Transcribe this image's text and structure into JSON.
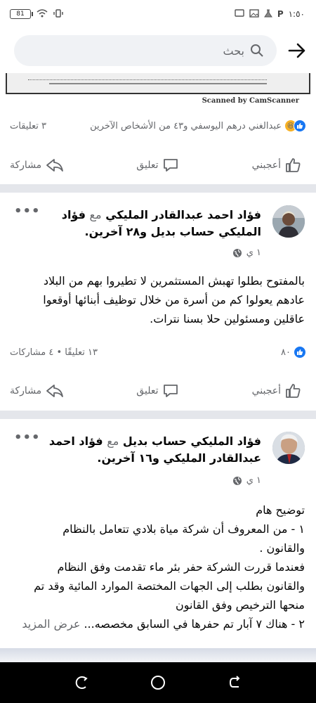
{
  "status_bar": {
    "battery": "81",
    "time": "١:٥٠"
  },
  "search": {
    "placeholder": "بحث"
  },
  "scan": {
    "caption": "Scanned by CamScanner"
  },
  "post0": {
    "reaction_names": "عبدالغني درهم اليوسفي و٤٣ من الأشخاص الآخرين",
    "comments": "٣ تعليقات"
  },
  "actions": {
    "like": "أعجبني",
    "comment": "تعليق",
    "share": "مشاركة"
  },
  "post1": {
    "author": "فؤاد احمد عبدالقادر المليكي",
    "with_word": "مع",
    "tagged": "فؤاد المليكي حساب بديل",
    "others": "و٢٨ آخرين.",
    "time": "١ ي",
    "body": [
      "بالمفتوح بطلوا تهبش المستثمرين لا تطيروا بهم من البلاد",
      "عادهم يعولوا كم من أسرة من خلال توظيف أبنائها أوقعوا",
      "عاقلين ومسئولين حلا بسنا نترات."
    ],
    "reactions": "٨٠",
    "stats": "١٣ تعليقًا • ٤ مشاركات"
  },
  "post2": {
    "author": "فؤاد المليكي حساب بديل",
    "with_word": "مع",
    "tagged": "فؤاد احمد عبدالقادر المليكي",
    "others": "و١٦ آخرين.",
    "time": "١ ي",
    "body": [
      "توضيح هام",
      "١ - من المعروف أن شركة مياة بلادي تتعامل بالنظام",
      "والقانون .",
      "فعندما قررت الشركة حفر بئر ماء تقدمت وفق النظام",
      "والقانون بطلب إلى الجهات المختصة الموارد المائية وقد تم",
      "منحها الترخيص وفق القانون"
    ],
    "last_line": "٢ - هناك ٧ آبار تم حفرها في السابق مخصصه...",
    "see_more": "عرض المزيد"
  },
  "colors": {
    "like_blue": "#1877f2",
    "divider": "#e4e6eb",
    "meta_gray": "#65676b"
  }
}
